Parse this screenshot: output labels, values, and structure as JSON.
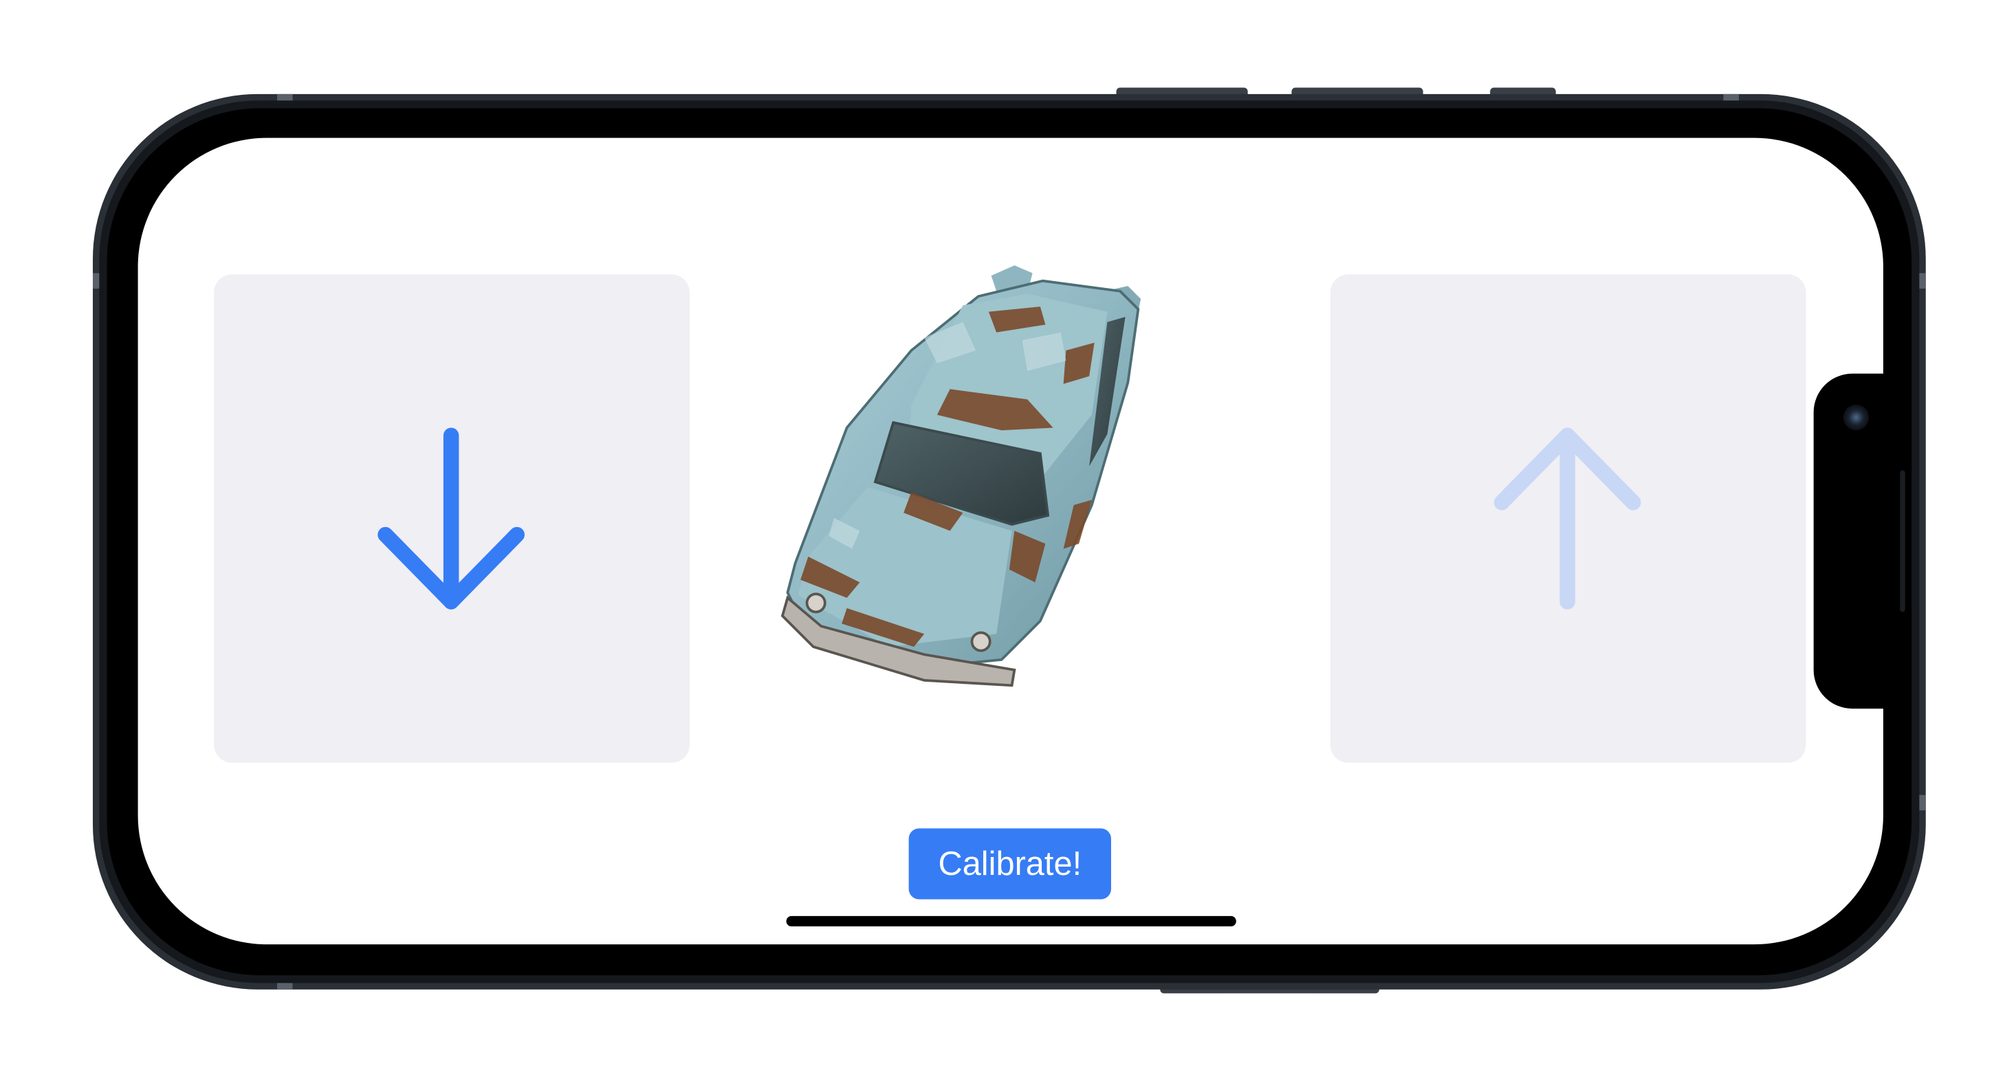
{
  "screen": {
    "calibrate_button": "Calibrate!",
    "left_tile": {
      "icon": "arrow-down-icon",
      "state": "active"
    },
    "right_tile": {
      "icon": "arrow-up-icon",
      "state": "inactive"
    },
    "model": {
      "icon": "rusty-vintage-car"
    }
  },
  "colors": {
    "accent": "#367cf5",
    "accent_faded": "#c7d7f5",
    "tile_background": "#efeff4",
    "frame": "#1e2126"
  }
}
